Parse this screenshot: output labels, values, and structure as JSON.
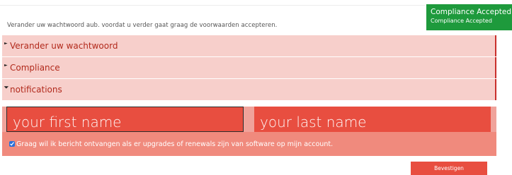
{
  "intro_text": "Verander uw wachtwoord aub. voordat u verder gaat graag de voorwaarden accepteren.",
  "toast": {
    "title": "Compliance Accepted",
    "message": "Compliance Accepted",
    "color": "#1e9a3c"
  },
  "sections": [
    {
      "label": "Verander uw wachtwoord",
      "expanded": false
    },
    {
      "label": "Compliance",
      "expanded": false
    },
    {
      "label": "notifications",
      "expanded": true
    }
  ],
  "form": {
    "first_name_placeholder": "your first name",
    "first_name_value": "",
    "last_name_placeholder": "your last name",
    "last_name_value": "",
    "consent_label": "Graag wil ik bericht ontvangen als er upgrades of renewals zijn van software op mijn account.",
    "consent_checked": true
  },
  "confirm_button": "Bevestigen",
  "colors": {
    "accent": "#e84e40",
    "section_bg": "#f7cfcb",
    "section_text": "#b22a1c"
  }
}
